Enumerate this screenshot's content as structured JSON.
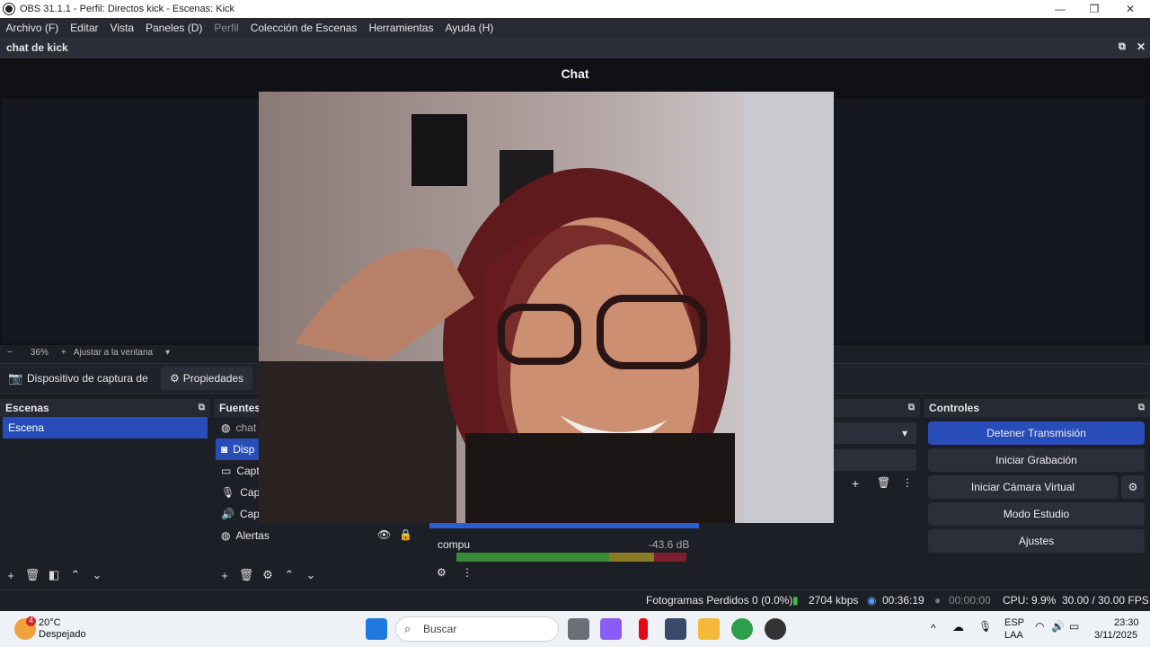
{
  "titlebar": {
    "title": "OBS 31.1.1 - Perfil: Directos kick - Escenas: Kick"
  },
  "menu": [
    "Archivo (F)",
    "Editar",
    "Vista",
    "Paneles (D)",
    "Perfil",
    "Colección de Escenas",
    "Herramientas",
    "Ayuda (H)"
  ],
  "chat_dock": {
    "header": "chat de kick",
    "title": "Chat"
  },
  "zoom": {
    "minus": "−",
    "value": "36%",
    "plus": "+",
    "fit": "Ajustar a la ventana"
  },
  "source_toolbar": {
    "source_name": "Dispositivo de captura de v",
    "properties": "Propiedades"
  },
  "scenes": {
    "header": "Escenas",
    "items": [
      "Escena"
    ]
  },
  "sources": {
    "header": "Fuentes",
    "items": [
      "chat",
      "Disp",
      "Capt",
      "Capt",
      "Capt",
      "Alertas"
    ]
  },
  "mixer": {
    "channel": "compu",
    "level": "-43.6 dB"
  },
  "controls": {
    "header": "Controles",
    "stop_stream": "Detener Transmisión",
    "start_record": "Iniciar Grabación",
    "virtual_cam": "Iniciar Cámara Virtual",
    "studio_mode": "Modo Estudio",
    "settings": "Ajustes"
  },
  "status": {
    "dropped": "Fotogramas Perdidos 0 (0.0%)",
    "bitrate": "2704 kbps",
    "stream_time": "00:36:19",
    "rec_time": "00:00:00",
    "cpu": "CPU: 9.9%",
    "fps": "30.00 / 30.00 FPS"
  },
  "taskbar": {
    "weather_temp": "20°C",
    "weather_desc": "Despejado",
    "weather_badge": "4",
    "search": "Buscar",
    "lang1": "ESP",
    "lang2": "LAA",
    "time": "23:30",
    "date": "3/11/2025"
  },
  "colors": {
    "accent": "#284cb8",
    "bg": "#1d1f26"
  }
}
